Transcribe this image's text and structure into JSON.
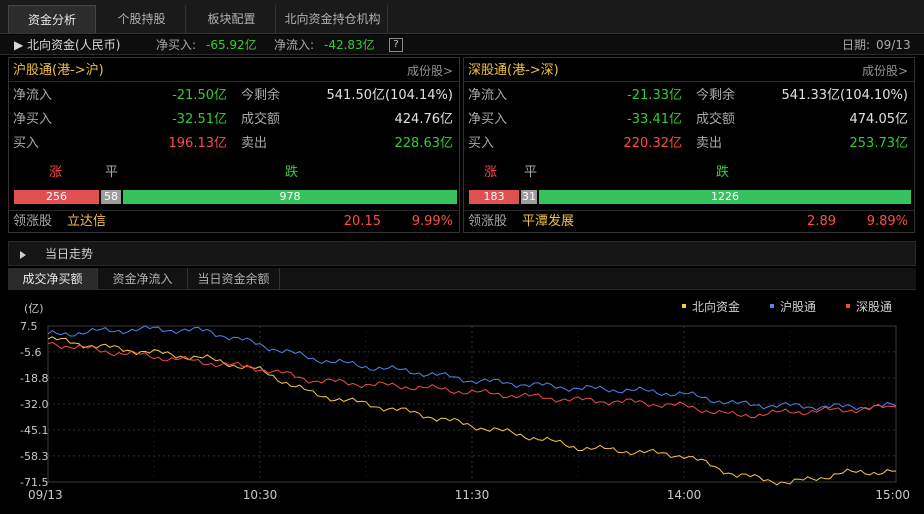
{
  "tabs": [
    {
      "label": "资金分析",
      "active": true
    },
    {
      "label": "个股持股",
      "active": false
    },
    {
      "label": "板块配置",
      "active": false
    },
    {
      "label": "北向资金持仓机构",
      "active": false
    }
  ],
  "northbound": {
    "title": "▶ 北向资金(人民币)",
    "net_buy_label": "净买入:",
    "net_buy": "-65.92亿",
    "net_inflow_label": "净流入:",
    "net_inflow": "-42.83亿",
    "help": "?",
    "date_label": "日期:",
    "date": "09/13"
  },
  "panels": {
    "sh": {
      "title": "沪股通(港->沪)",
      "link": "成份股>",
      "net_inflow_label": "净流入",
      "net_inflow": "-21.50亿",
      "remaining_label": "今剩余",
      "remaining": "541.50亿(104.14%)",
      "net_buy_label": "净买入",
      "net_buy": "-32.51亿",
      "turnover_label": "成交额",
      "turnover": "424.76亿",
      "buy_label": "买入",
      "buy": "196.13亿",
      "sell_label": "卖出",
      "sell": "228.63亿",
      "up_label": "涨",
      "flat_label": "平",
      "down_label": "跌",
      "up_count": "256",
      "flat_count": "58",
      "down_count": "978",
      "leader_label": "领涨股",
      "leader": "立达信",
      "leader_price": "20.15",
      "leader_pct": "9.99%"
    },
    "sz": {
      "title": "深股通(港->深)",
      "link": "成份股>",
      "net_inflow_label": "净流入",
      "net_inflow": "-21.33亿",
      "remaining_label": "今剩余",
      "remaining": "541.33亿(104.10%)",
      "net_buy_label": "净买入",
      "net_buy": "-33.41亿",
      "turnover_label": "成交额",
      "turnover": "474.05亿",
      "buy_label": "买入",
      "buy": "220.32亿",
      "sell_label": "卖出",
      "sell": "253.73亿",
      "up_label": "涨",
      "flat_label": "平",
      "down_label": "跌",
      "up_count": "183",
      "flat_count": "31",
      "down_count": "1226",
      "leader_label": "领涨股",
      "leader": "平潭发展",
      "leader_price": "2.89",
      "leader_pct": "9.89%"
    }
  },
  "trend": {
    "title": "当日走势",
    "subtabs": [
      {
        "label": "成交净买额",
        "active": true
      },
      {
        "label": "资金净流入",
        "active": false
      },
      {
        "label": "当日资金余额",
        "active": false
      }
    ]
  },
  "colors": {
    "northbound": "#f5c84a",
    "hgt": "#4f86f0",
    "sgt": "#f04b4b",
    "up_bar": "#e05050",
    "flat_bar": "#9c9c9c",
    "down_bar": "#36c25c"
  },
  "chart_data": {
    "type": "line",
    "ylabel": "(亿)",
    "yticks": [
      "7.5",
      "-5.6",
      "-18.8",
      "-32.0",
      "-45.1",
      "-58.3",
      "-71.5"
    ],
    "ylim": [
      -71.5,
      7.5
    ],
    "xticks": [
      "09/13",
      "10:30",
      "11:30",
      "14:00",
      "15:00"
    ],
    "grid": true,
    "legend_position": "top-right",
    "x_minutes": [
      0,
      15,
      30,
      45,
      60,
      75,
      90,
      105,
      120,
      135,
      150,
      165,
      180,
      195,
      210,
      225,
      240
    ],
    "series": [
      {
        "name": "北向资金",
        "color": "#f5c84a",
        "values": [
          1.0,
          -3.0,
          -6.0,
          -9.0,
          -15.0,
          -27.0,
          -32.0,
          -37.0,
          -43.0,
          -48.0,
          -54.0,
          -56.0,
          -58.0,
          -68.0,
          -72.0,
          -67.0,
          -66.0
        ]
      },
      {
        "name": "沪股通",
        "color": "#4f86f0",
        "values": [
          3.0,
          5.0,
          6.0,
          5.0,
          -2.0,
          -9.0,
          -13.0,
          -16.0,
          -20.0,
          -22.0,
          -24.0,
          -25.0,
          -27.0,
          -32.0,
          -33.0,
          -33.5,
          -33.0
        ]
      },
      {
        "name": "深股通",
        "color": "#f04b4b",
        "values": [
          -1.0,
          -5.0,
          -8.0,
          -11.0,
          -14.0,
          -20.0,
          -22.0,
          -23.5,
          -26.0,
          -28.0,
          -30.0,
          -31.0,
          -33.0,
          -38.0,
          -36.0,
          -35.0,
          -33.5
        ]
      }
    ]
  }
}
